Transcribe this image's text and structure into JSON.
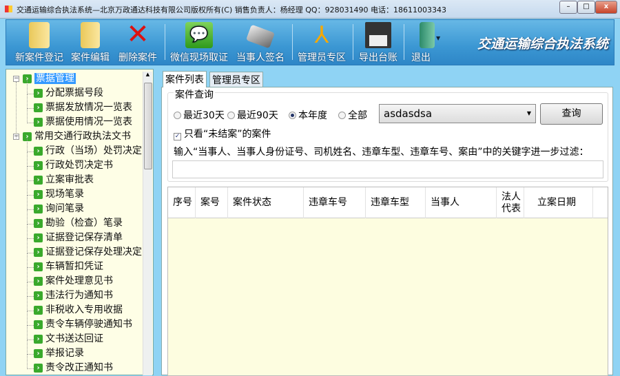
{
  "window": {
    "title": "交通运输综合执法系统—北京万政通达科技有限公司版权所有(C) 销售负责人：杨经理 QQ：928031490 电话：18611003343",
    "minimize": "–",
    "maximize": "□",
    "close": "x"
  },
  "toolbar": {
    "buttons": [
      {
        "label": "新案件登记",
        "icon": "folder-icon"
      },
      {
        "label": "案件编辑",
        "icon": "folder-icon"
      },
      {
        "label": "删除案件",
        "icon": "red-x-icon"
      },
      {
        "label": "微信现场取证",
        "icon": "wechat-icon"
      },
      {
        "label": "当事人签名",
        "icon": "signature-pad-icon"
      },
      {
        "label": "管理员专区",
        "icon": "running-man-icon"
      },
      {
        "label": "导出台账",
        "icon": "floppy-disk-icon"
      },
      {
        "label": "退出",
        "icon": "exit-door-icon"
      }
    ],
    "brand": "交通运输综合执法系统"
  },
  "tree": [
    {
      "label": "票据管理",
      "selected": true,
      "children": [
        "分配票据号段",
        "票据发放情况一览表",
        "票据使用情况一览表"
      ]
    },
    {
      "label": "常用交通行政执法文书",
      "children": [
        "行政（当场）处罚决定",
        "行政处罚决定书",
        "立案审批表",
        "现场笔录",
        "询问笔录",
        "勘验（检查）笔录",
        "证据登记保存清单",
        "证据登记保存处理决定",
        "车辆暂扣凭证",
        "案件处理意见书",
        "违法行为通知书",
        "非税收入专用收据",
        "责令车辆停驶通知书",
        "文书送达回证",
        "举报记录",
        "责令改正通知书"
      ]
    }
  ],
  "tabs": [
    "案件列表",
    "管理员专区"
  ],
  "query": {
    "group_label": "案件查询",
    "radios": [
      {
        "label": "最近30天",
        "checked": false
      },
      {
        "label": "最近90天",
        "checked": false
      },
      {
        "label": "本年度",
        "checked": true
      },
      {
        "label": "全部",
        "checked": false
      }
    ],
    "combo_value": "asdasdsa",
    "search_button": "查询",
    "only_open_label": "只看“未结案”的案件",
    "only_open_checked": true,
    "hint": "输入“当事人、当事人身份证号、司机姓名、违章车型、违章车号、案由”中的关键字进一步过滤：",
    "keyword": ""
  },
  "table": {
    "columns": [
      "序号",
      "案号",
      "案件状态",
      "违章车号",
      "违章车型",
      "当事人",
      "法人代表",
      "立案日期"
    ],
    "rows": []
  }
}
